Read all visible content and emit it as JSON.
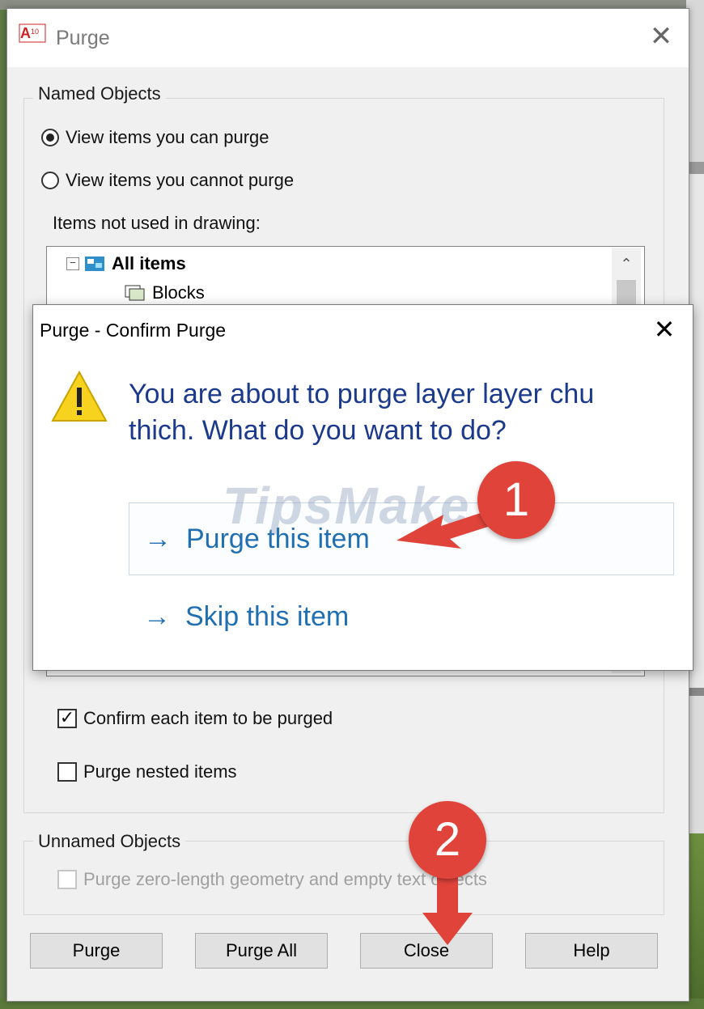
{
  "purge_dialog": {
    "title": "Purge",
    "named_objects": {
      "label": "Named Objects",
      "radio_can": {
        "label": "View items you can purge",
        "selected": true
      },
      "radio_cannot": {
        "label": "View items you cannot purge",
        "selected": false
      },
      "items_label": "Items not used in drawing:",
      "tree": [
        {
          "label": "All items",
          "bold": true
        },
        {
          "label": "Blocks",
          "bold": false
        }
      ]
    },
    "confirm_each": {
      "label": "Confirm each item to be purged",
      "checked": true
    },
    "purge_nested": {
      "label": "Purge nested items",
      "checked": false
    },
    "unnamed_objects": {
      "label": "Unnamed Objects",
      "zero_length": {
        "label": "Purge zero-length geometry and empty text objects",
        "checked": false,
        "enabled": false
      }
    },
    "buttons": {
      "purge": "Purge",
      "purge_all": "Purge All",
      "close": "Close",
      "help": "Help"
    }
  },
  "confirm_dialog": {
    "title": "Purge - Confirm Purge",
    "instruction": "You are about to purge layer layer chu thich. What do you want to do?",
    "options": [
      {
        "label": "Purge this item",
        "arrow": "→"
      },
      {
        "label": "Skip this item",
        "arrow": "→"
      }
    ]
  },
  "annotations": {
    "watermark": "TipsMake",
    "step1": "1",
    "step2": "2",
    "color": "#e0433a"
  },
  "icons": {
    "close": "✕",
    "check": "✓",
    "scroll_up": "⌃",
    "expand": "⊟"
  }
}
